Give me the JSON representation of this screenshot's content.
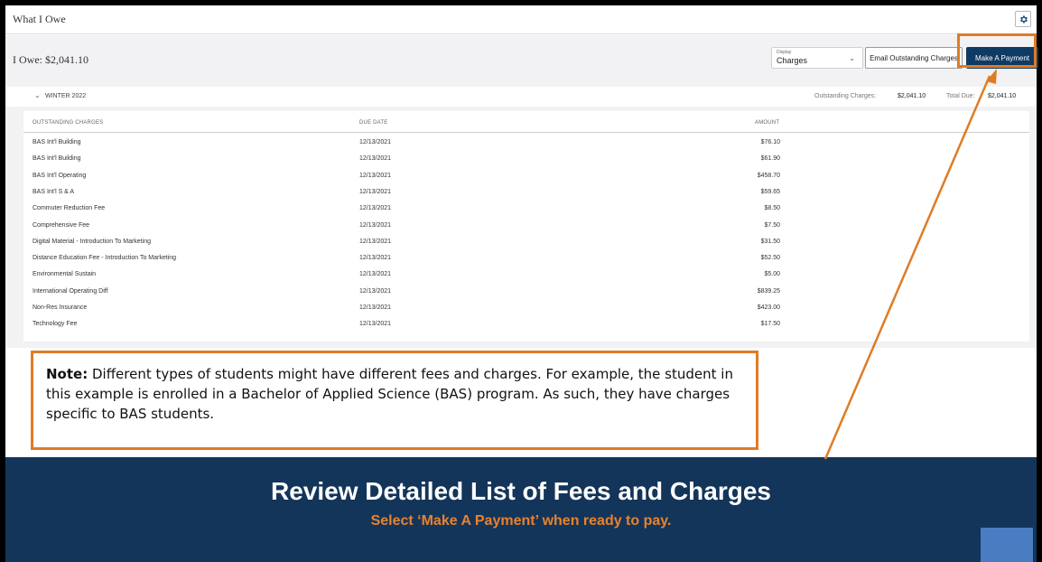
{
  "title_bar": {
    "title": "What I Owe",
    "settings_icon": "gear-icon"
  },
  "summary": {
    "owe_label": "I Owe: $2,041.10"
  },
  "controls": {
    "display": {
      "label": "Display",
      "value": "Charges"
    },
    "email_button": "Email Outstanding Charges",
    "pay_button": "Make A Payment"
  },
  "term": {
    "name": "WINTER 2022",
    "outstanding_label": "Outstanding Charges:",
    "outstanding_value": "$2,041.10",
    "total_due_label": "Total Due:",
    "total_due_value": "$2,041.10"
  },
  "table": {
    "headers": [
      "OUTSTANDING CHARGES",
      "DUE DATE",
      "AMOUNT"
    ],
    "rows": [
      [
        "BAS Int'l Building",
        "12/13/2021",
        "$76.10"
      ],
      [
        "BAS Int'l Building",
        "12/13/2021",
        "$61.90"
      ],
      [
        "BAS Int'l Operating",
        "12/13/2021",
        "$458.70"
      ],
      [
        "BAS Int'l S & A",
        "12/13/2021",
        "$59.65"
      ],
      [
        "Commuter Reduction Fee",
        "12/13/2021",
        "$8.50"
      ],
      [
        "Comprehensive Fee",
        "12/13/2021",
        "$7.50"
      ],
      [
        "Digital Material - Introduction To Marketing",
        "12/13/2021",
        "$31.50"
      ],
      [
        "Distance Education Fee - Introduction To Marketing",
        "12/13/2021",
        "$52.50"
      ],
      [
        "Environmental Sustain",
        "12/13/2021",
        "$5.00"
      ],
      [
        "International Operating Diff",
        "12/13/2021",
        "$839.25"
      ],
      [
        "Non-Res Insurance",
        "12/13/2021",
        "$423.00"
      ],
      [
        "Technology Fee",
        "12/13/2021",
        "$17.50"
      ]
    ]
  },
  "note": {
    "bold": "Note:",
    "text": " Different types of students might have different fees and charges. For example, the student in this example is enrolled in a Bachelor of Applied Science (BAS) program. As such, they have charges specific to BAS students."
  },
  "banner": {
    "headline": "Review Detailed List of Fees and Charges",
    "subline": "Select ‘Make A Payment’ when ready to pay."
  },
  "colors": {
    "accent_orange": "#e07b25",
    "navy": "#14355a",
    "button_navy": "#0f3a63"
  }
}
